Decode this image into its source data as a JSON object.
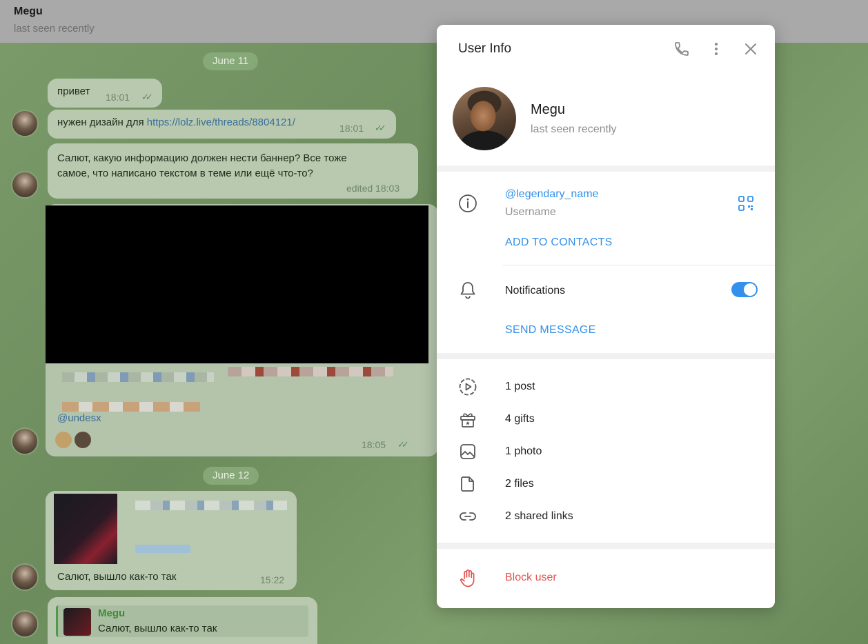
{
  "chat": {
    "header": {
      "name": "Megu",
      "status": "last seen recently"
    },
    "dates": [
      "June 11",
      "June 12"
    ],
    "messages": [
      {
        "text": "привет",
        "time": "18:01"
      },
      {
        "text_prefix": "нужен дизайн для ",
        "link": "https://lolz.live/threads/8804121/",
        "time": "18:01"
      },
      {
        "line1": "Салют, какую информацию должен нести баннер? Все тоже",
        "line2": "самое, что написано текстом в теме или ещё что-то?",
        "time": "edited 18:03"
      },
      {
        "mention": "@undesx",
        "time": "18:05"
      },
      {
        "text": "Салют, вышло как-то так",
        "time": "15:22"
      },
      {
        "reply_author": "Megu",
        "reply_text": "Салют, вышло как-то так"
      }
    ],
    "ticks": "✓✓"
  },
  "panel": {
    "title": "User Info",
    "user": {
      "name": "Megu",
      "status": "last seen recently"
    },
    "username": {
      "value": "@legendary_name",
      "label": "Username"
    },
    "add_contact": "ADD TO CONTACTS",
    "notifications": {
      "label": "Notifications",
      "enabled": true
    },
    "send_message": "SEND MESSAGE",
    "media": [
      {
        "icon": "stories-icon",
        "label": "1 post"
      },
      {
        "icon": "gift-icon",
        "label": "4 gifts"
      },
      {
        "icon": "photo-icon",
        "label": "1 photo"
      },
      {
        "icon": "file-icon",
        "label": "2 files"
      },
      {
        "icon": "link-icon",
        "label": "2 shared links"
      }
    ],
    "block": "Block user",
    "colors": {
      "accent": "#3390ec",
      "danger": "#e0534f"
    }
  }
}
